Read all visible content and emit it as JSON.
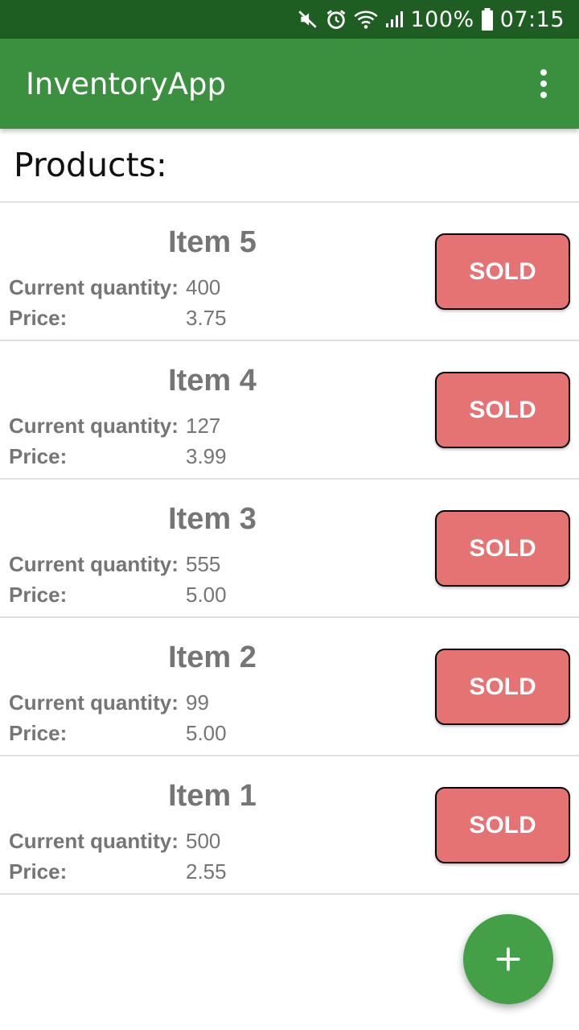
{
  "status_bar": {
    "icons": [
      "mute-icon",
      "alarm-icon",
      "wifi-icon",
      "signal-icon"
    ],
    "battery_text": "100%",
    "time": "07:15"
  },
  "app_bar": {
    "title": "InventoryApp",
    "menu_icon": "overflow-menu-icon"
  },
  "header": {
    "title": "Products:"
  },
  "products": [
    {
      "name": "Item 5",
      "quantity_label": "Current quantity:",
      "quantity": "400",
      "price_label": "Price:",
      "price": "3.75",
      "sold_label": "SOLD"
    },
    {
      "name": "Item 4",
      "quantity_label": "Current quantity:",
      "quantity": "127",
      "price_label": "Price:",
      "price": "3.99",
      "sold_label": "SOLD"
    },
    {
      "name": "Item 3",
      "quantity_label": "Current quantity:",
      "quantity": "555",
      "price_label": "Price:",
      "price": "5.00",
      "sold_label": "SOLD"
    },
    {
      "name": "Item 2",
      "quantity_label": "Current quantity:",
      "quantity": "99",
      "price_label": "Price:",
      "price": "5.00",
      "sold_label": "SOLD"
    },
    {
      "name": "Item 1",
      "quantity_label": "Current quantity:",
      "quantity": "500",
      "price_label": "Price:",
      "price": "2.55",
      "sold_label": "SOLD"
    }
  ],
  "fab": {
    "icon": "plus-icon"
  },
  "colors": {
    "status_bar": "#1e5e22",
    "app_bar": "#3b903f",
    "sold_button": "#e57373",
    "fab": "#43a047",
    "item_text": "#757575"
  }
}
